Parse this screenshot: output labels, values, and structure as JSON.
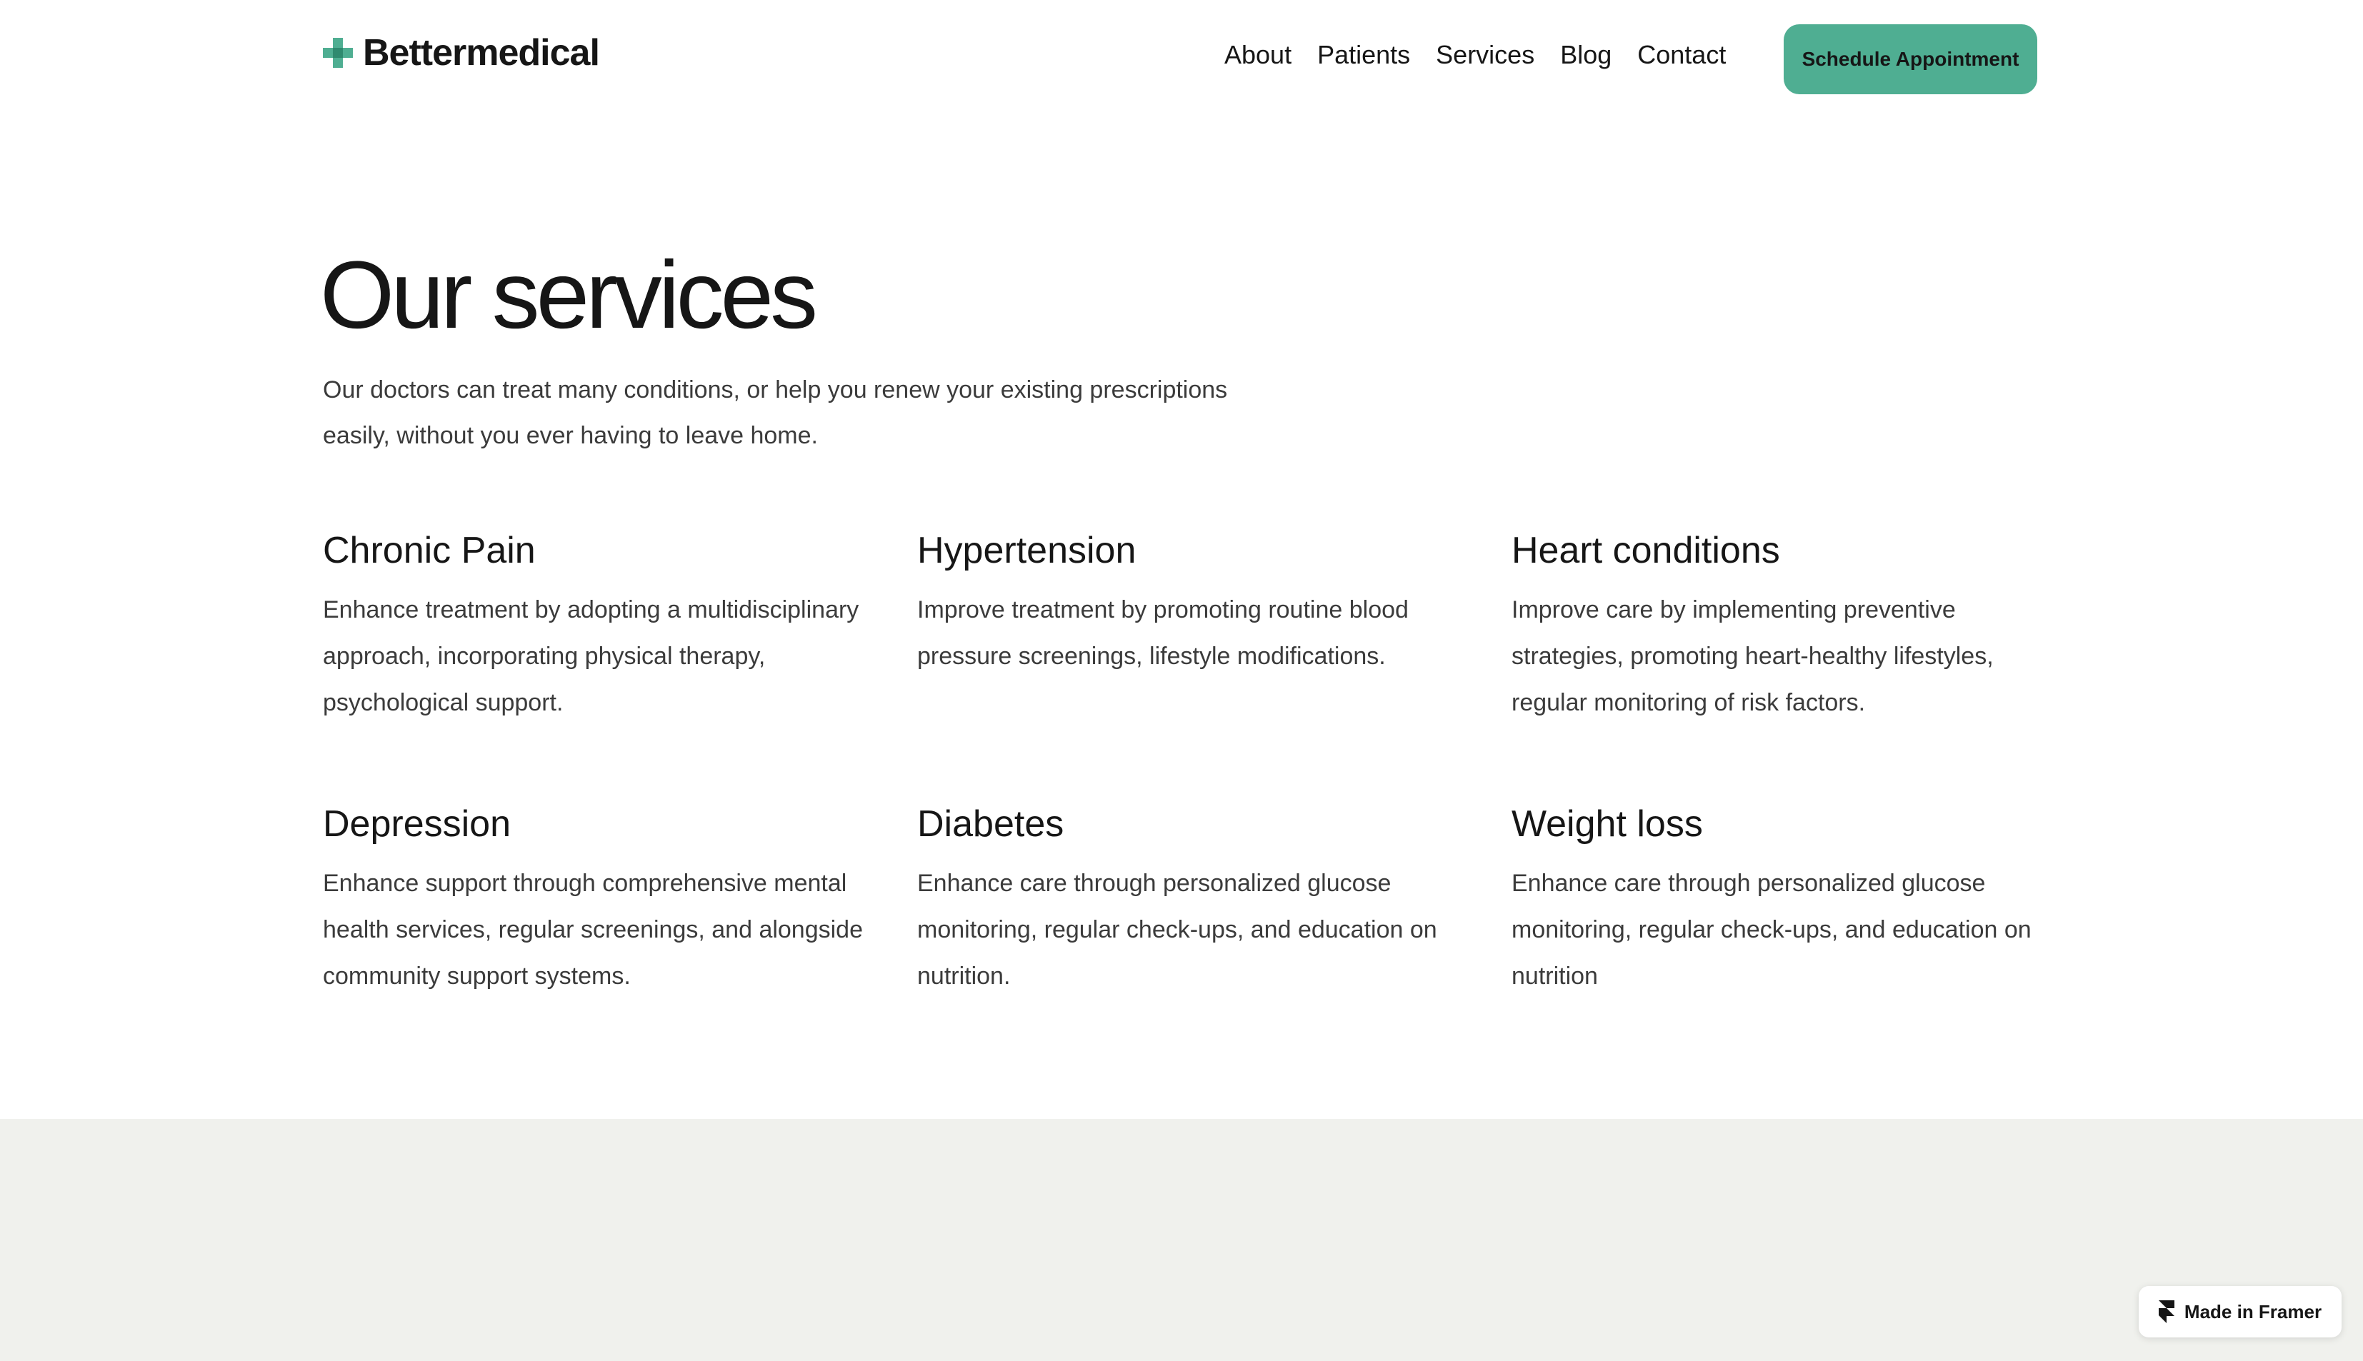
{
  "brand": {
    "name": "Bettermedical",
    "icon": "medical-cross-icon",
    "accent_color": "#4fae92"
  },
  "nav": {
    "items": [
      "About",
      "Patients",
      "Services",
      "Blog",
      "Contact"
    ]
  },
  "cta": {
    "label": "Schedule Appointment"
  },
  "hero": {
    "title": "Our services",
    "subtitle": "Our doctors can treat many conditions, or help you renew your existing prescriptions easily, without you ever having to leave home."
  },
  "services": [
    {
      "title": "Chronic Pain",
      "description": "Enhance treatment by adopting a multidisciplinary approach, incorporating physical therapy, psychological support."
    },
    {
      "title": "Hypertension",
      "description": "Improve treatment by promoting routine blood pressure screenings, lifestyle modifications."
    },
    {
      "title": "Heart conditions",
      "description": "Improve care by implementing preventive strategies, promoting heart-healthy lifestyles, regular monitoring of risk factors."
    },
    {
      "title": "Depression",
      "description": "Enhance support through comprehensive mental health services, regular screenings, and alongside community support systems."
    },
    {
      "title": "Diabetes",
      "description": "Enhance care through personalized glucose monitoring, regular check-ups, and education on nutrition."
    },
    {
      "title": "Weight loss",
      "description": "Enhance care through personalized glucose monitoring, regular check-ups, and education on nutrition"
    }
  ],
  "badge": {
    "label": "Made in Framer",
    "icon": "framer-logo-icon"
  },
  "colors": {
    "section_background": "#f0f1ed",
    "text_primary": "#161616",
    "text_secondary": "#3b3b3b"
  }
}
